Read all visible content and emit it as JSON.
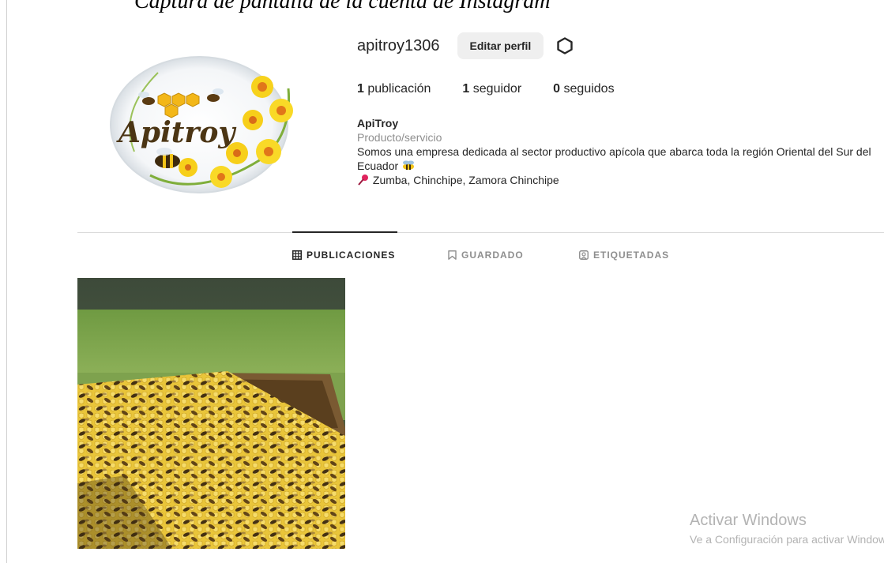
{
  "caption": {
    "text": "Captura de pantalla de la cuenta de Instagram"
  },
  "profile": {
    "username": "apitroy1306",
    "edit_label": "Editar perfil",
    "settings_icon": "gear-icon",
    "avatar_text": "Apitroy",
    "stats": {
      "posts_count": "1",
      "posts_label": "publicación",
      "followers_count": "1",
      "followers_label": "seguidor",
      "following_count": "0",
      "following_label": "seguidos"
    },
    "bio": {
      "name": "ApiTroy",
      "category": "Producto/servicio",
      "description": "Somos una empresa dedicada al sector productivo apícola que abarca toda la región Oriental del Sur del Ecuador",
      "location": "Zumba, Chinchipe, Zamora Chinchipe"
    }
  },
  "tabs": [
    {
      "label": "PUBLICACIONES",
      "icon": "grid-icon",
      "active": true
    },
    {
      "label": "GUARDADO",
      "icon": "bookmark-icon",
      "active": false
    },
    {
      "label": "ETIQUETADAS",
      "icon": "tag-user-icon",
      "active": false
    }
  ],
  "watermark": {
    "title": "Activar Windows",
    "subtitle": "Ve a Configuración para activar Windows."
  },
  "colors": {
    "text": "#262626",
    "muted": "#8e8e8e",
    "button_bg": "#efefef",
    "divider": "#dbdbdb",
    "honey": "#f2c418"
  }
}
